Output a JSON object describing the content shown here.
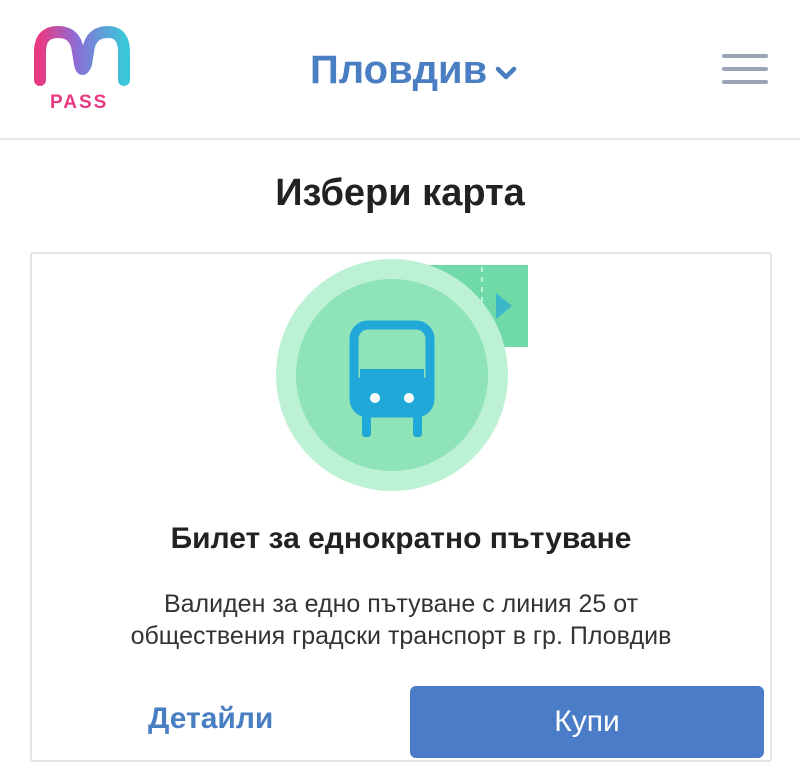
{
  "header": {
    "logo_text": "PASS",
    "city": "Пловдив",
    "menu_icon": "hamburger-menu-icon",
    "chevron_icon": "chevron-down-icon"
  },
  "page": {
    "title": "Избери карта"
  },
  "card": {
    "icon": "bus-icon",
    "title": "Билет за еднократно пътуване",
    "description_line1": "Валиден за едно пътуване с линия 25 от",
    "description_line2": "обществения градски транспорт в гр. Пловдив",
    "details_label": "Детайли",
    "buy_label": "Купи"
  },
  "colors": {
    "accent_blue": "#4a7cc8",
    "logo_pink": "#e83a83",
    "logo_cyan": "#3cc6d8",
    "illustration_green": "#a8ecc8",
    "bus_blue": "#1fa8d8"
  }
}
